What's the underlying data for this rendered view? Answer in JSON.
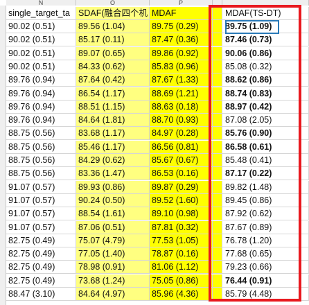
{
  "column_letters": [
    "N",
    "O",
    "P",
    "",
    ""
  ],
  "columns": [
    "single_target_ta",
    "SDAF(融合四个机",
    "MDAF",
    "",
    "MDAF(TS-DT)"
  ],
  "rows": [
    {
      "a": "90.02 (0.51)",
      "b": "89.56 (1.04)",
      "c": "89.75 (0.29)",
      "d": "89.75 (1.09)",
      "bold": true
    },
    {
      "a": "90.02 (0.51)",
      "b": "85.17 (0.11)",
      "c": "87.47 (0.36)",
      "d": "87.46 (0.73)",
      "bold": true
    },
    {
      "a": "90.02 (0.51)",
      "b": "89.07 (0.65)",
      "c": "89.86 (0.92)",
      "d": "90.06 (0.86)",
      "bold": true
    },
    {
      "a": "90.02 (0.51)",
      "b": "84.33 (0.62)",
      "c": "85.83 (0.96)",
      "d": "85.08 (0.32)",
      "bold": false
    },
    {
      "a": "89.76 (0.94)",
      "b": "87.64 (0.42)",
      "c": "87.67 (1.33)",
      "d": "88.62 (0.86)",
      "bold": true
    },
    {
      "a": "89.76 (0.94)",
      "b": "86.54 (1.17)",
      "c": "88.69 (1.21)",
      "d": "88.74 (0.83)",
      "bold": true
    },
    {
      "a": "89.76 (0.94)",
      "b": "88.51 (1.15)",
      "c": "88.63 (0.18)",
      "d": "88.97 (0.42)",
      "bold": true
    },
    {
      "a": "89.76 (0.94)",
      "b": "84.64 (1.81)",
      "c": "88.70 (0.93)",
      "d": "87.08 (2.05)",
      "bold": false
    },
    {
      "a": "88.75 (0.56)",
      "b": "83.68 (1.17)",
      "c": "84.97 (0.28)",
      "d": "85.76 (0.90)",
      "bold": true
    },
    {
      "a": "88.75 (0.56)",
      "b": "85.46 (1.17)",
      "c": "86.56 (0.81)",
      "d": "86.58 (0.61)",
      "bold": true
    },
    {
      "a": "88.75 (0.56)",
      "b": "84.29 (0.62)",
      "c": "85.67 (0.67)",
      "d": "85.48 (0.41)",
      "bold": false
    },
    {
      "a": "88.75 (0.56)",
      "b": "83.36 (1.47)",
      "c": "86.53 (0.16)",
      "d": "87.17 (0.22)",
      "bold": true
    },
    {
      "a": "91.07 (0.57)",
      "b": "89.93 (0.86)",
      "c": "89.87 (0.29)",
      "d": "89.82 (1.48)",
      "bold": false
    },
    {
      "a": "91.07 (0.57)",
      "b": "90.24 (0.50)",
      "c": "89.52 (1.60)",
      "d": "89.45 (0.86)",
      "bold": false
    },
    {
      "a": "91.07 (0.57)",
      "b": "88.54 (1.61)",
      "c": "89.10 (0.98)",
      "d": "87.92 (0.62)",
      "bold": false
    },
    {
      "a": "91.07 (0.57)",
      "b": "87.06 (0.51)",
      "c": "87.81 (0.32)",
      "d": "87.67 (0.89)",
      "bold": false
    },
    {
      "a": "82.75 (0.49)",
      "b": "75.07 (4.79)",
      "c": "77.53 (1.05)",
      "d": "76.78 (1.20)",
      "bold": false
    },
    {
      "a": "82.75 (0.49)",
      "b": "77.05 (1.40)",
      "c": "78.87 (0.16)",
      "d": "77.68 (0.65)",
      "bold": false
    },
    {
      "a": "82.75 (0.49)",
      "b": "78.98 (0.91)",
      "c": "81.06 (1.12)",
      "d": "79.23 (0.66)",
      "bold": false
    },
    {
      "a": "82.75 (0.49)",
      "b": "73.68 (1.24)",
      "c": "75.05 (0.86)",
      "d": "76.44 (0.91)",
      "bold": true
    },
    {
      "a": "88.47 (3.10)",
      "b": "84.64 (4.97)",
      "c": "85.96 (4.36)",
      "d": "85.79 (4.48)",
      "bold": false
    }
  ],
  "colors": {
    "highlight_yellow": "#ffff00",
    "light_yellow": "#ffff80",
    "selection_red": "#e8191f"
  }
}
